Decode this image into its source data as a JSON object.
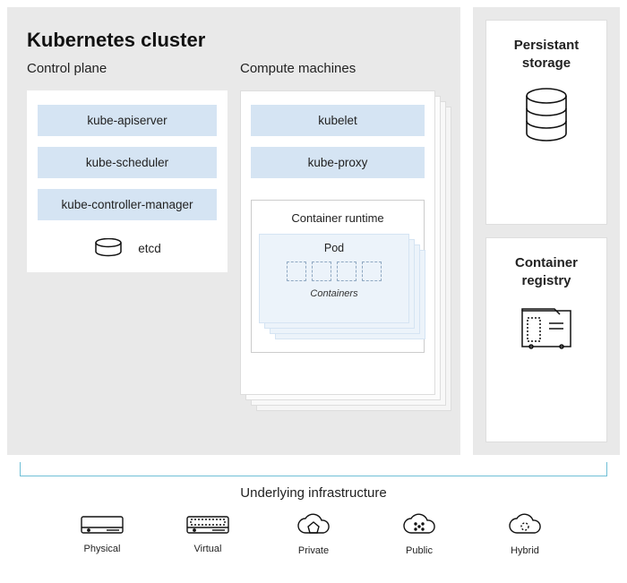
{
  "cluster": {
    "title": "Kubernetes cluster",
    "control_plane": {
      "title": "Control plane",
      "items": [
        "kube-apiserver",
        "kube-scheduler",
        "kube-controller-manager"
      ],
      "etcd": "etcd"
    },
    "compute": {
      "title": "Compute machines",
      "items": [
        "kubelet",
        "kube-proxy"
      ],
      "runtime_title": "Container runtime",
      "pod_title": "Pod",
      "containers_label": "Containers"
    }
  },
  "sidebar": {
    "storage_title": "Persistant storage",
    "registry_title": "Container registry"
  },
  "infra": {
    "title": "Underlying infrastructure",
    "items": [
      "Physical",
      "Virtual",
      "Private",
      "Public",
      "Hybrid"
    ]
  }
}
